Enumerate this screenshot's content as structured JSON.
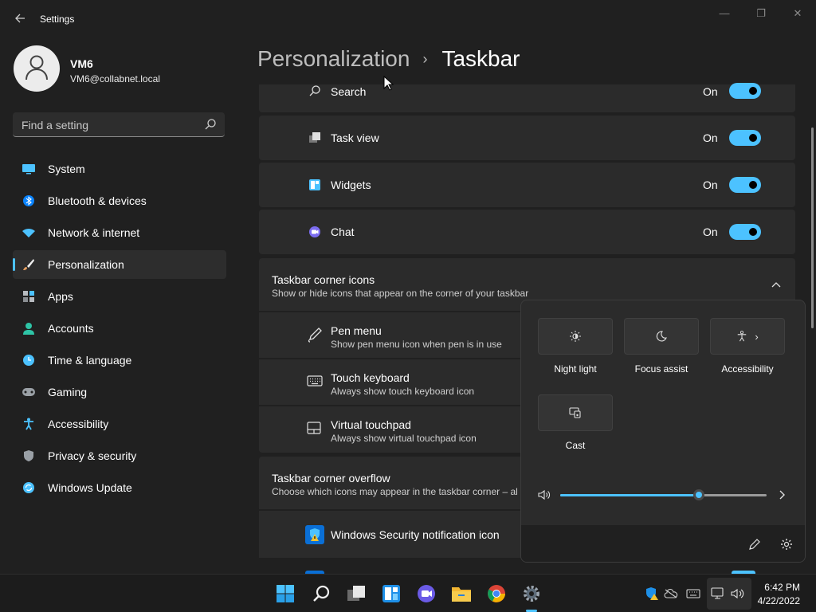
{
  "window": {
    "title": "Settings",
    "minimize_glyph": "—",
    "restore_glyph": "❐",
    "close_glyph": "✕"
  },
  "user": {
    "name": "VM6",
    "email": "VM6@collabnet.local"
  },
  "search": {
    "placeholder": "Find a setting",
    "icon": "search-icon"
  },
  "nav": {
    "items": [
      {
        "label": "System",
        "icon": "monitor-icon",
        "color": "#4cc2ff"
      },
      {
        "label": "Bluetooth & devices",
        "icon": "bluetooth-icon",
        "color": "#0a84ff"
      },
      {
        "label": "Network & internet",
        "icon": "wifi-icon",
        "color": "#4cc2ff"
      },
      {
        "label": "Personalization",
        "icon": "brush-icon",
        "color": "#e8a060",
        "selected": true
      },
      {
        "label": "Apps",
        "icon": "apps-icon",
        "color": "#9aa0a6"
      },
      {
        "label": "Accounts",
        "icon": "person-icon",
        "color": "#2ec4a6"
      },
      {
        "label": "Time & language",
        "icon": "clock-globe-icon",
        "color": "#4cc2ff"
      },
      {
        "label": "Gaming",
        "icon": "gamepad-icon",
        "color": "#9aa0a6"
      },
      {
        "label": "Accessibility",
        "icon": "accessibility-icon",
        "color": "#4cc2ff"
      },
      {
        "label": "Privacy & security",
        "icon": "shield-icon",
        "color": "#9aa0a6"
      },
      {
        "label": "Windows Update",
        "icon": "update-icon",
        "color": "#4cc2ff"
      }
    ]
  },
  "header": {
    "parent": "Personalization",
    "separator": "›",
    "current": "Taskbar"
  },
  "taskbar_items": [
    {
      "label": "Search",
      "state": "On",
      "icon": "search-icon"
    },
    {
      "label": "Task view",
      "state": "On",
      "icon": "task-view-icon"
    },
    {
      "label": "Widgets",
      "state": "On",
      "icon": "widgets-icon"
    },
    {
      "label": "Chat",
      "state": "On",
      "icon": "chat-icon"
    }
  ],
  "corner_icons": {
    "title": "Taskbar corner icons",
    "subtitle": "Show or hide icons that appear on the corner of your taskbar",
    "items": [
      {
        "label": "Pen menu",
        "sub": "Show pen menu icon when pen is in use",
        "icon": "pen-icon"
      },
      {
        "label": "Touch keyboard",
        "sub": "Always show touch keyboard icon",
        "icon": "keyboard-icon"
      },
      {
        "label": "Virtual touchpad",
        "sub": "Always show virtual touchpad icon",
        "icon": "touchpad-icon"
      }
    ]
  },
  "corner_overflow": {
    "title": "Taskbar corner overflow",
    "subtitle": "Choose which icons may appear in the taskbar corner – al",
    "items": [
      {
        "label": "Windows Security notification icon",
        "icon": "windows-security-icon"
      }
    ]
  },
  "quick_settings": {
    "buttons": [
      {
        "label": "Night light",
        "icon": "brightness-icon"
      },
      {
        "label": "Focus assist",
        "icon": "moon-icon"
      },
      {
        "label": "Accessibility",
        "icon": "accessibility-icon",
        "chevron": "›"
      },
      {
        "label": "Cast",
        "icon": "cast-icon"
      }
    ],
    "volume": {
      "level": 0.67,
      "icon": "speaker-icon"
    },
    "edit_icon": "pencil-icon",
    "settings_icon": "gear-icon"
  },
  "taskbar": {
    "pinned": [
      {
        "name": "start",
        "icon": "windows-logo-icon"
      },
      {
        "name": "search",
        "icon": "search-icon"
      },
      {
        "name": "task-view",
        "icon": "task-view-icon"
      },
      {
        "name": "widgets",
        "icon": "widgets-icon"
      },
      {
        "name": "chat",
        "icon": "chat-icon"
      },
      {
        "name": "file-explorer",
        "icon": "folder-icon"
      },
      {
        "name": "chrome",
        "icon": "chrome-icon"
      },
      {
        "name": "settings",
        "icon": "gear-icon",
        "active": true
      }
    ],
    "clock": {
      "time": "6:42 PM",
      "date": "4/22/2022"
    }
  }
}
